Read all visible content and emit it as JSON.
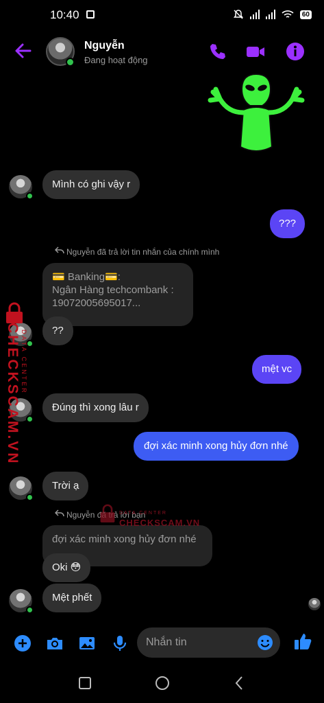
{
  "status": {
    "time": "10:40",
    "battery": "60"
  },
  "header": {
    "name": "Nguyễn",
    "status": "Đang hoạt động"
  },
  "messages": {
    "m1": "Mình có ghi vậy r",
    "m2": "???",
    "reply_note_1": "Nguyễn đã trả lời tin nhắn của chính mình",
    "quote1": "💳 Banking💳:\nNgân Hàng techcombank :\n19072005695017...",
    "m3": "??",
    "m4": "mệt vc",
    "m5": "Đúng thì xong lâu r",
    "m6": "đợi xác minh xong hủy đơn nhé",
    "m7": "Trời ạ",
    "reply_note_2": "Nguyễn đã trả lời bạn",
    "quote2": "đợi xác minh xong hủy đơn nhé",
    "m8": "Oki 😳",
    "m9": "Mệt phết"
  },
  "watermark": {
    "main": "CHECKSCAM.VN",
    "sub": "DATA CENTER",
    "small_main": "CHECKSCAM.VN",
    "small_sub": "DATA CENTER"
  },
  "composer": {
    "placeholder": "Nhắn tin"
  },
  "colors": {
    "accent": "#9b30ff",
    "messenger_blue": "#2d8cff",
    "bubble_out": "#5b45f5"
  }
}
